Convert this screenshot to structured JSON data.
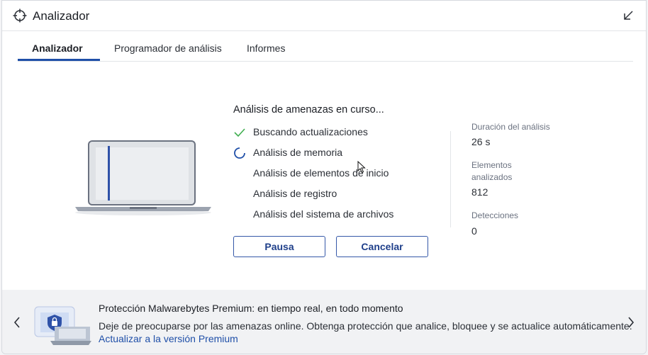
{
  "window": {
    "title": "Analizador",
    "icons": {
      "title": "crosshair-icon",
      "collapse": "collapse-arrow-icon"
    }
  },
  "tabs": [
    {
      "label": "Analizador",
      "active": true
    },
    {
      "label": "Programador de análisis",
      "active": false
    },
    {
      "label": "Informes",
      "active": false
    }
  ],
  "scan": {
    "title": "Análisis de amenazas en curso...",
    "steps": [
      {
        "label": "Buscando actualizaciones",
        "status": "done",
        "icon": "check-icon"
      },
      {
        "label": "Análisis de memoria",
        "status": "in-progress",
        "icon": "spinner-icon"
      },
      {
        "label": "Análisis de elementos de inicio",
        "status": "pending"
      },
      {
        "label": "Análisis de registro",
        "status": "pending"
      },
      {
        "label": "Análisis del sistema de archivos",
        "status": "pending"
      }
    ],
    "pause_label": "Pausa",
    "cancel_label": "Cancelar"
  },
  "stats": {
    "duration": {
      "label": "Duración del análisis",
      "value": "26 s"
    },
    "scanned": {
      "label": "Elementos analizados",
      "value": "812"
    },
    "detections": {
      "label": "Detecciones",
      "value": "0"
    }
  },
  "promo": {
    "title": "Protección Malwarebytes Premium: en tiempo real, en todo momento",
    "description": "Deje de preocuparse por las amenazas online. Obtenga protección que analice, bloquee y se actualice automáticamente.",
    "link": "Actualizar a la versión Premium"
  },
  "colors": {
    "accent": "#1f4fa8",
    "check": "#3fae4f",
    "button_border": "#3558a8"
  }
}
